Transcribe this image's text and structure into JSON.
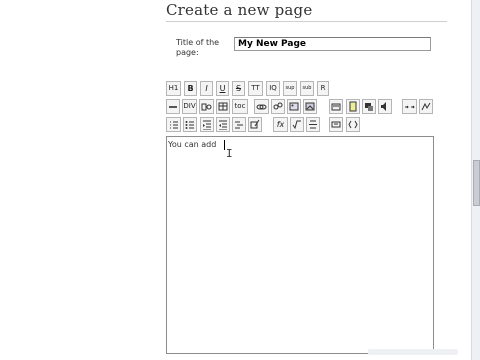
{
  "page": {
    "heading": "Create a new page"
  },
  "title_field": {
    "label": "Title of the page:",
    "value": "My New Page"
  },
  "toolbar": {
    "row1": [
      "H1",
      "B",
      "I",
      "U",
      "S",
      "TT",
      "IQ",
      "sup",
      "sub",
      "R"
    ],
    "row2": [
      "hr",
      "DIV",
      "anchor",
      "table",
      "toc",
      "link",
      "unlink",
      "image",
      "image-link",
      "insert-image",
      "attach",
      "user",
      "sound",
      "indent",
      "more"
    ],
    "row3": [
      "ordered-list",
      "unordered-list",
      "outdent",
      "indent-list",
      "definition-list",
      "edit-table",
      "fx",
      "sqrt",
      "fraction",
      "flash",
      "code"
    ]
  },
  "editor": {
    "content": "You can add "
  },
  "icons": {
    "caret": "text-caret",
    "cursor": "i-beam-cursor"
  }
}
